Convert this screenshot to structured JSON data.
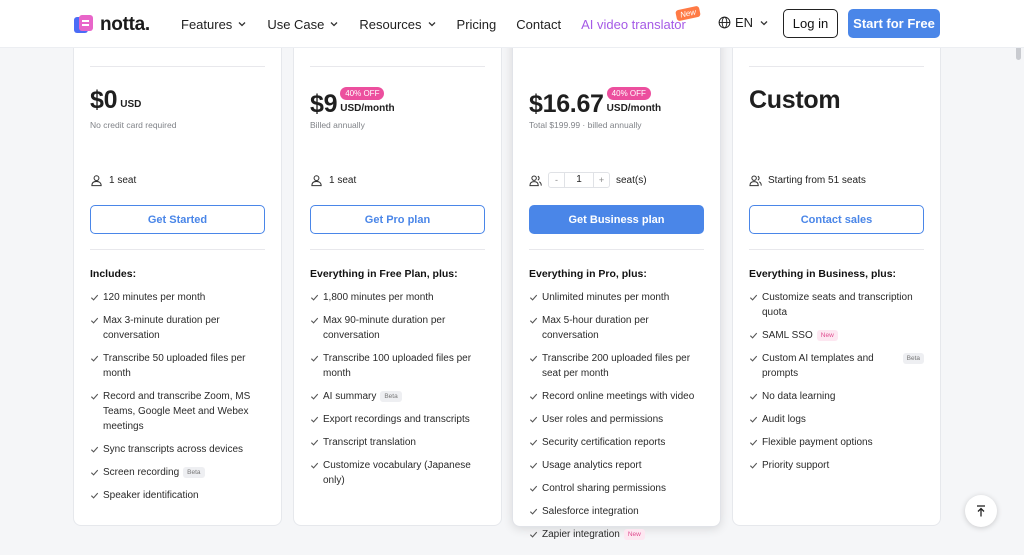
{
  "nav": {
    "logo_text": "notta.",
    "menu": [
      {
        "label": "Features",
        "has_dropdown": true
      },
      {
        "label": "Use Case",
        "has_dropdown": true
      },
      {
        "label": "Resources",
        "has_dropdown": true
      },
      {
        "label": "Pricing",
        "has_dropdown": false
      },
      {
        "label": "Contact",
        "has_dropdown": false
      }
    ],
    "ai_label": "AI video translator",
    "ai_badge": "New",
    "lang": "EN",
    "login": "Log in",
    "start": "Start for Free"
  },
  "plans": [
    {
      "price": "$0",
      "unit": "USD",
      "badge": "",
      "note": "No credit card required",
      "seats": "1 seat",
      "cta": "Get Started",
      "features_title": "Includes:",
      "features": [
        {
          "text": "120 minutes per month"
        },
        {
          "text": "Max 3-minute duration per conversation"
        },
        {
          "text": "Transcribe 50 uploaded files per month"
        },
        {
          "text": "Record and transcribe Zoom, MS Teams, Google Meet and Webex meetings"
        },
        {
          "text": "Sync transcripts across devices"
        },
        {
          "text": "Screen recording",
          "tag": "Beta"
        },
        {
          "text": "Speaker identification"
        }
      ]
    },
    {
      "price": "$9",
      "unit": "USD/month",
      "badge": "40% OFF",
      "note": "Billed annually",
      "seats": "1 seat",
      "cta": "Get Pro plan",
      "features_title": "Everything in Free Plan, plus:",
      "features": [
        {
          "text": "1,800 minutes per month"
        },
        {
          "text": "Max 90-minute duration per conversation"
        },
        {
          "text": "Transcribe 100 uploaded files per month"
        },
        {
          "text": "AI summary",
          "tag": "Beta"
        },
        {
          "text": "Export recordings and transcripts"
        },
        {
          "text": "Transcript translation"
        },
        {
          "text": "Customize vocabulary (Japanese only)"
        }
      ]
    },
    {
      "price": "$16.67",
      "unit": "USD/month",
      "badge": "40% OFF",
      "note": "Total $199.99 · billed annually",
      "seat_count": "1",
      "seats_suffix": "seat(s)",
      "stepper_minus": "-",
      "stepper_plus": "+",
      "cta": "Get Business plan",
      "features_title": "Everything in Pro, plus:",
      "features": [
        {
          "text": "Unlimited minutes per month"
        },
        {
          "text": "Max 5-hour duration per conversation"
        },
        {
          "text": "Transcribe 200 uploaded files per seat per month"
        },
        {
          "text": "Record online meetings with video"
        },
        {
          "text": "User roles and permissions"
        },
        {
          "text": "Security certification reports"
        },
        {
          "text": "Usage analytics report"
        },
        {
          "text": "Control sharing permissions"
        },
        {
          "text": "Salesforce integration"
        },
        {
          "text": "Zapier integration",
          "tag": "New"
        }
      ]
    },
    {
      "price": "Custom",
      "note": "",
      "seats": "Starting from 51 seats",
      "cta": "Contact sales",
      "features_title": "Everything in Business, plus:",
      "features": [
        {
          "text": "Customize seats and transcription quota"
        },
        {
          "text": "SAML SSO",
          "tag": "New"
        },
        {
          "text": "Custom AI templates and prompts",
          "tag": "Beta"
        },
        {
          "text": "No data learning"
        },
        {
          "text": "Audit logs"
        },
        {
          "text": "Flexible payment options"
        },
        {
          "text": "Priority support"
        }
      ]
    }
  ],
  "colors": {
    "accent": "#4a86e8",
    "badge_pink": "#ec4f9e",
    "ai_purple": "#a55ae6"
  }
}
